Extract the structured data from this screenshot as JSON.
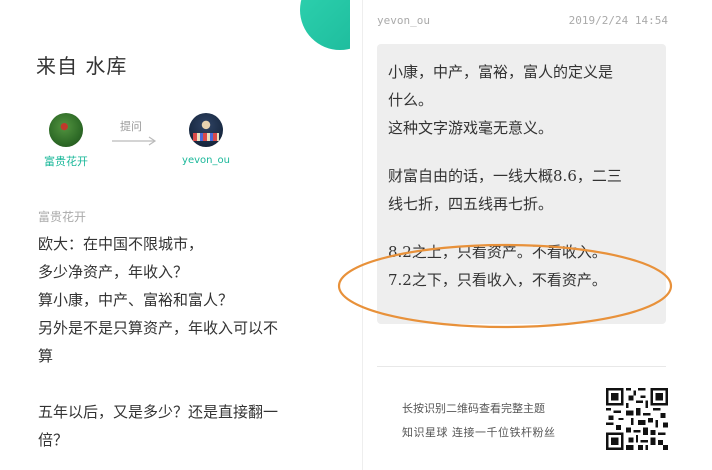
{
  "left": {
    "source": "来自  水库",
    "asker": {
      "name": "富贵花开"
    },
    "answerer": {
      "name": "yevon_ou"
    },
    "ask_label": "提问",
    "question": {
      "author": "富贵花开",
      "lines": [
        "欧大：在中国不限城市，",
        "多少净资产，年收入？",
        "算小康，中产、富裕和富人？",
        "另外是不是只算资产，年收入可以不",
        "算",
        "",
        "五年以后，又是多少？还是直接翻一",
        "倍？"
      ]
    }
  },
  "right": {
    "answer_user": "yevon_ou",
    "answer_time": "2019/2/24 14:54",
    "answer_lines": [
      "小康，中产，富裕，富人的定义是",
      "什么。",
      "这种文字游戏毫无意义。",
      "",
      "财富自由的话，一线大概8.6，二三",
      "线七折，四五线再七折。",
      "",
      "8.2之上，只看资产。不看收入。",
      "7.2之下，只看收入，不看资产。"
    ],
    "footer": {
      "line1": "长按识别二维码查看完整主题",
      "line2": "知识星球 连接一千位铁杆粉丝"
    }
  },
  "colors": {
    "accent": "#1bb89a",
    "highlight": "#e8913a",
    "answer_bg": "#eeeeee"
  },
  "icons": {
    "ask_arrow": "arrow-right-icon",
    "qr": "qr-code-icon"
  }
}
